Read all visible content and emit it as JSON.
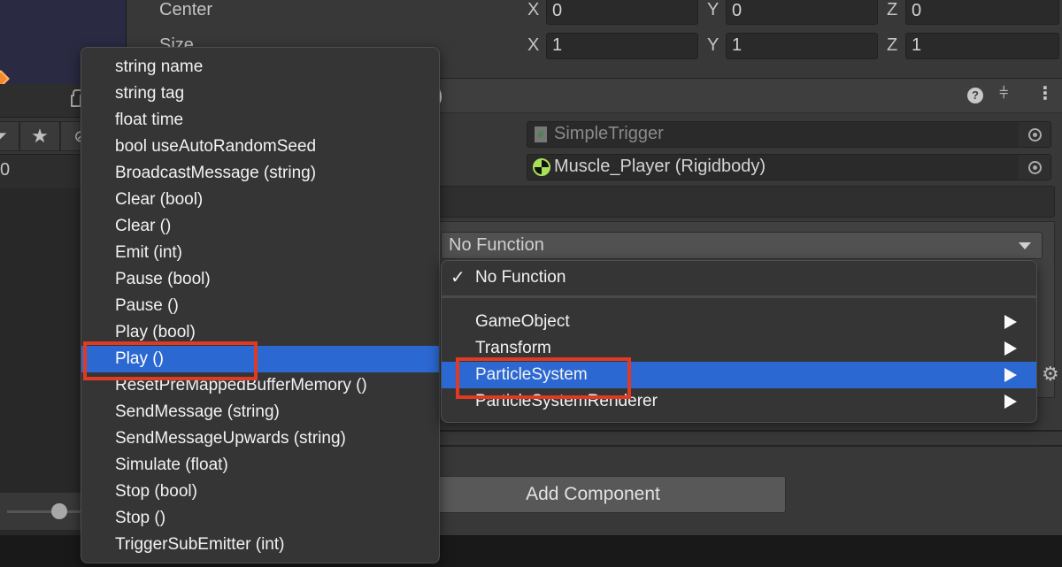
{
  "inspector": {
    "center_label": "Center",
    "size_label": "Size",
    "center": {
      "x_label": "X",
      "x": "0",
      "y_label": "Y",
      "y": "0",
      "z_label": "Z",
      "z": "0"
    },
    "size": {
      "x_label": "X",
      "x": "1",
      "y_label": "Y",
      "y": "1",
      "z_label": "Z",
      "z": "1"
    },
    "component_title_tail": ")",
    "header_icons": {
      "help": "?",
      "presets": "⫩",
      "more": "⋮"
    },
    "script_field": "SimpleTrigger",
    "target_field": "Muscle_Player (Rigidbody)",
    "function_dropdown": "No Function",
    "add_component_label": "Add Component"
  },
  "left_pane": {
    "value": "0",
    "toolbar_icons": [
      "filter",
      "star",
      "eye-slash"
    ]
  },
  "method_menu": {
    "items": [
      {
        "label": "string name",
        "selected": false
      },
      {
        "label": "string tag",
        "selected": false
      },
      {
        "label": "float time",
        "selected": false
      },
      {
        "label": "bool useAutoRandomSeed",
        "selected": false
      },
      {
        "label": "BroadcastMessage (string)",
        "selected": false
      },
      {
        "label": "Clear (bool)",
        "selected": false
      },
      {
        "label": "Clear ()",
        "selected": false
      },
      {
        "label": "Emit (int)",
        "selected": false
      },
      {
        "label": "Pause (bool)",
        "selected": false
      },
      {
        "label": "Pause ()",
        "selected": false
      },
      {
        "label": "Play (bool)",
        "selected": false
      },
      {
        "label": "Play ()",
        "selected": true
      },
      {
        "label": "ResetPreMappedBufferMemory ()",
        "selected": false
      },
      {
        "label": "SendMessage (string)",
        "selected": false
      },
      {
        "label": "SendMessageUpwards (string)",
        "selected": false
      },
      {
        "label": "Simulate (float)",
        "selected": false
      },
      {
        "label": "Stop (bool)",
        "selected": false
      },
      {
        "label": "Stop ()",
        "selected": false
      },
      {
        "label": "TriggerSubEmitter (int)",
        "selected": false
      }
    ]
  },
  "component_menu": {
    "checked_item": {
      "check": "✓",
      "label": "No Function"
    },
    "items": [
      {
        "label": "GameObject",
        "selected": false
      },
      {
        "label": "Transform",
        "selected": false
      },
      {
        "label": "ParticleSystem",
        "selected": true
      },
      {
        "label": "ParticleSystemRenderer",
        "selected": false
      }
    ]
  },
  "colors": {
    "selection": "#2c68d1",
    "annotation": "#e03a24",
    "panel": "#383838",
    "menu": "#353535"
  }
}
